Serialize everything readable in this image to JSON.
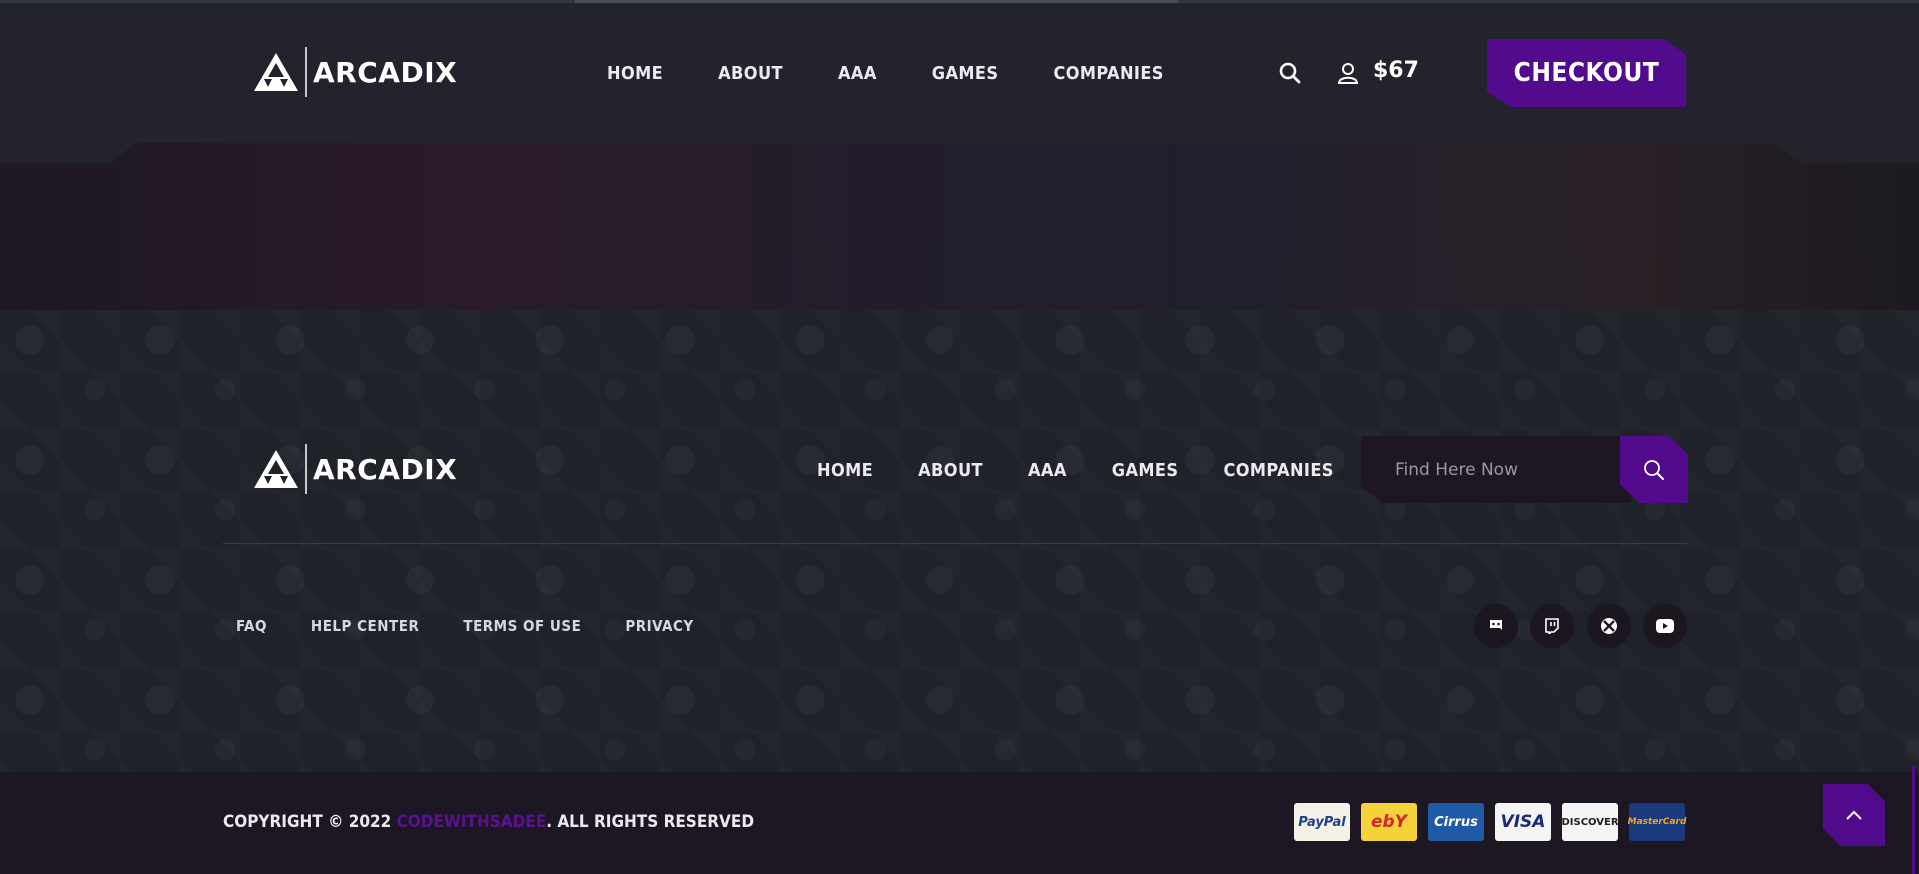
{
  "header": {
    "brand": "ARCADIX",
    "nav": [
      "HOME",
      "ABOUT",
      "AAA",
      "GAMES",
      "COMPANIES"
    ],
    "cart_total": "$67",
    "checkout_label": "CHECKOUT",
    "icons": [
      "search-icon",
      "user-icon"
    ]
  },
  "footer": {
    "brand": "ARCADIX",
    "nav": [
      "HOME",
      "ABOUT",
      "AAA",
      "GAMES",
      "COMPANIES"
    ],
    "search": {
      "placeholder": "Find Here Now",
      "icon": "search-icon"
    },
    "links": [
      "FAQ",
      "HELP CENTER",
      "TERMS OF USE",
      "PRIVACY"
    ],
    "social": [
      "discord-icon",
      "twitch-icon",
      "xbox-icon",
      "youtube-icon"
    ]
  },
  "bottom": {
    "copyright_prefix": "COPYRIGHT © 2022 ",
    "copyright_brand": "CODEWITHSADEE",
    "copyright_suffix": ". ALL RIGHTS RESERVED",
    "payments": [
      "PayPal",
      "ebY",
      "Cirrus",
      "VISA",
      "DISCOVER",
      "MasterCard"
    ]
  },
  "colors": {
    "accent": "#520b8c",
    "header_bg": "#22232c",
    "footer_bg": "#1f2229",
    "bottom_bg": "#1d1623"
  }
}
